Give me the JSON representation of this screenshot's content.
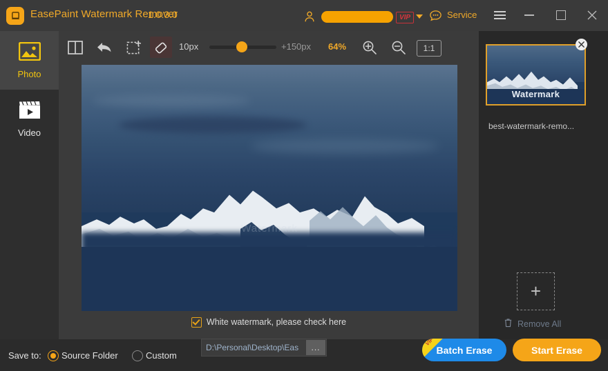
{
  "titlebar": {
    "app_name": "EasePaint Watermark Remover",
    "version": "1.0.3.0",
    "logo_icon": "app-logo-icon",
    "account_icon": "user-icon",
    "vip_badge": "VIP",
    "dropdown_icon": "chevron-down-icon",
    "service_icon": "chat-bubble-icon",
    "service_label": "Service",
    "menu_icon": "hamburger-menu-icon",
    "minimize_icon": "minimize-icon",
    "maximize_icon": "maximize-icon",
    "close_icon": "close-icon"
  },
  "sidebar": {
    "items": [
      {
        "label": "Photo",
        "icon": "photo-icon",
        "active": true
      },
      {
        "label": "Video",
        "icon": "video-clapperboard-icon",
        "active": false
      }
    ]
  },
  "toolbar": {
    "split_view_icon": "split-view-icon",
    "undo_icon": "undo-arrow-icon",
    "crop_icon": "crop-select-icon",
    "eraser_icon": "eraser-icon",
    "brush_min": "10px",
    "brush_max": "+150px",
    "zoom_level": "64%",
    "zoom_in_icon": "zoom-in-icon",
    "zoom_out_icon": "zoom-out-icon",
    "actual_size_label": "1:1"
  },
  "canvas": {
    "watermark_text": "Watermark",
    "checkbox_label": "White watermark, please check here",
    "checkbox_checked": true
  },
  "right_panel": {
    "thumbnail_watermark": "Watermark",
    "thumbnail_filename": "best-watermark-remo...",
    "remove_thumb_icon": "close-icon",
    "add_icon": "plus-icon",
    "trash_icon": "trash-icon",
    "remove_all_label": "Remove All"
  },
  "bottom_bar": {
    "save_to_label": "Save to:",
    "option_source": "Source Folder",
    "option_custom": "Custom",
    "selected_option": "Source Folder",
    "path_value": "D:\\Personal\\Desktop\\Eas",
    "browse_label": "...",
    "batch_erase_label": "Batch Erase",
    "batch_vip_tag": "VIP",
    "start_erase_label": "Start Erase"
  },
  "colors": {
    "accent_orange": "#f5a518",
    "title_text": "#f0a929",
    "vip_red": "#d8353d",
    "batch_blue": "#1e8ae8",
    "panel_dark": "#282828",
    "panel_mid": "#3b3b3b"
  }
}
